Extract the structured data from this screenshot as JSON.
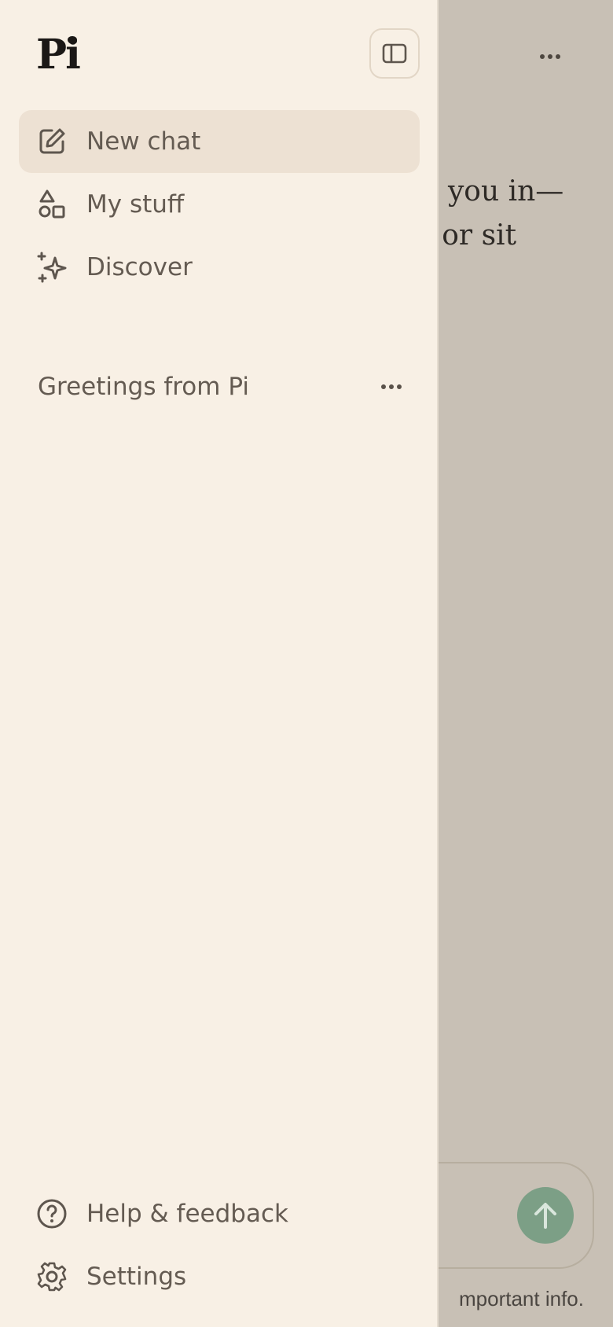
{
  "app": {
    "logo_text": "Pi"
  },
  "sidebar": {
    "nav": [
      {
        "label": "New chat",
        "icon": "edit-icon",
        "active": true
      },
      {
        "label": "My stuff",
        "icon": "shapes-icon",
        "active": false
      },
      {
        "label": "Discover",
        "icon": "sparkle-icon",
        "active": false
      }
    ],
    "threads": [
      {
        "label": "Greetings from Pi"
      }
    ],
    "footer": [
      {
        "label": "Help & feedback",
        "icon": "help-icon"
      },
      {
        "label": "Settings",
        "icon": "gear-icon"
      }
    ]
  },
  "chat": {
    "lines": [
      "re you in—",
      "w or sit"
    ],
    "disclaimer": "mportant info."
  },
  "colors": {
    "sidebar_bg": "#f8f0e5",
    "active_bg": "#ede1d3",
    "overlay": "#c8c0b5",
    "send_button": "#7c9f86",
    "text": "#645b52"
  }
}
